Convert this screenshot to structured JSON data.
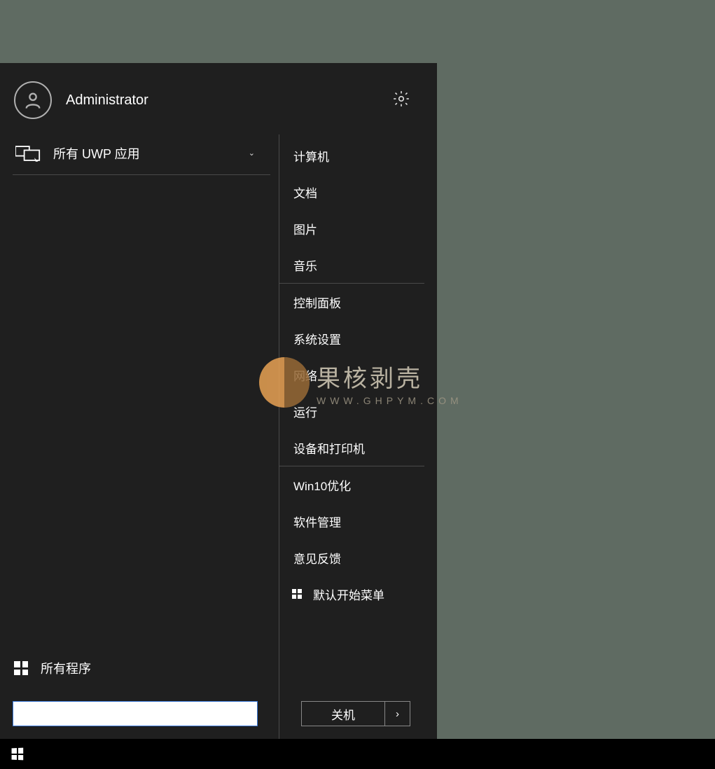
{
  "user": {
    "name": "Administrator"
  },
  "left": {
    "uwp_label": "所有 UWP 应用",
    "all_programs": "所有程序",
    "search_value": ""
  },
  "right": {
    "groups": [
      [
        "计算机",
        "文档",
        "图片",
        "音乐"
      ],
      [
        "控制面板",
        "系统设置",
        "网络",
        "运行",
        "设备和打印机"
      ],
      [
        "Win10优化",
        "软件管理",
        "意见反馈"
      ]
    ],
    "default_menu": "默认开始菜单"
  },
  "power": {
    "shutdown": "关机"
  },
  "watermark": {
    "title": "果核剥壳",
    "sub": "WWW.GHPYM.COM"
  }
}
